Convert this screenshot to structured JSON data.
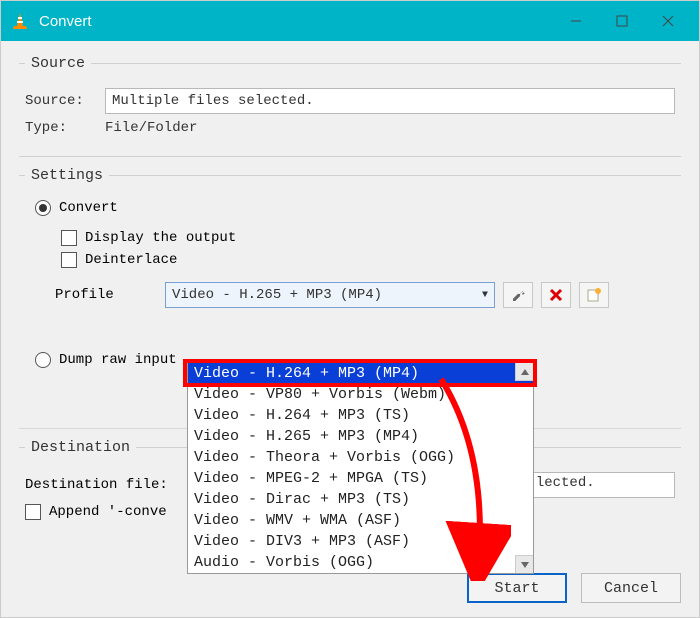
{
  "window": {
    "title": "Convert",
    "buttons": {
      "min": "—",
      "max": "☐",
      "close": "✕"
    }
  },
  "source": {
    "legend": "Source",
    "source_label": "Source:",
    "source_value": "Multiple files selected.",
    "type_label": "Type:",
    "type_value": "File/Folder"
  },
  "settings": {
    "legend": "Settings",
    "convert_label": "Convert",
    "display_output_label": "Display the output",
    "deinterlace_label": "Deinterlace",
    "profile_label": "Profile",
    "profile_selected": "Video - H.265 + MP3 (MP4)",
    "profile_options": [
      "Video - H.264 + MP3 (MP4)",
      "Video - VP80 + Vorbis (Webm)",
      "Video - H.264 + MP3 (TS)",
      "Video - H.265 + MP3 (MP4)",
      "Video - Theora + Vorbis (OGG)",
      "Video - MPEG-2 + MPGA (TS)",
      "Video - Dirac + MP3 (TS)",
      "Video - WMV + WMA (ASF)",
      "Video - DIV3 + MP3 (ASF)",
      "Audio - Vorbis (OGG)"
    ],
    "dump_raw_label": "Dump raw input"
  },
  "destination": {
    "legend": "Destination",
    "file_label": "Destination file:",
    "file_value_visible": "lected.",
    "append_label": "Append '-conve"
  },
  "footer": {
    "start": "Start",
    "cancel": "Cancel"
  },
  "icons": {
    "wrench": "wrench-icon",
    "delete": "delete-icon",
    "new": "new-profile-icon"
  }
}
